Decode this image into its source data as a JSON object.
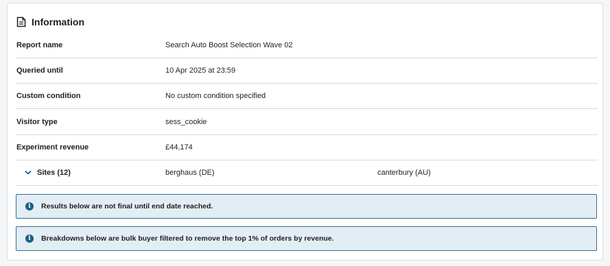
{
  "panel": {
    "title": "Information",
    "header_icon": "document-icon"
  },
  "rows": [
    {
      "label": "Report name",
      "value": "Search Auto Boost Selection Wave 02"
    },
    {
      "label": "Queried until",
      "value": "10 Apr 2025 at 23:59"
    },
    {
      "label": "Custom condition",
      "value": "No custom condition specified"
    },
    {
      "label": "Visitor type",
      "value": "sess_cookie"
    },
    {
      "label": "Experiment revenue",
      "value": "£44,174"
    }
  ],
  "sites": {
    "label": "Sites (12)",
    "expand_icon": "chevron-down-icon",
    "items": [
      "berghaus (DE)",
      "canterbury (AU)"
    ]
  },
  "notices": [
    {
      "icon": "info-icon",
      "text": "Results below are not final until end date reached."
    },
    {
      "icon": "info-icon",
      "text": "Breakdowns below are bulk buyer filtered to remove the top 1% of orders by revenue."
    }
  ],
  "colors": {
    "notice_bg": "#e3edf4",
    "notice_border": "#2f6f95",
    "accent": "#1d5f87"
  }
}
